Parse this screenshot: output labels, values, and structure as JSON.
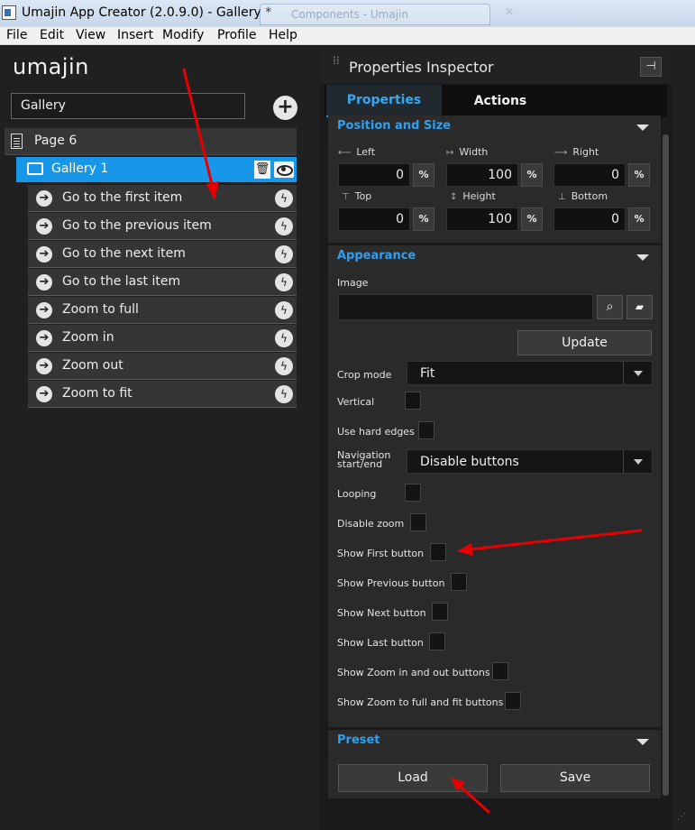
{
  "window": {
    "title": "Umajin App Creator (2.0.9.0) - Gallery *",
    "background_tab": "Components - Umajin"
  },
  "menu": [
    "File",
    "Edit",
    "View",
    "Insert",
    "Modify",
    "Profile",
    "Help"
  ],
  "left_panel": {
    "logo": "umajin",
    "page_field_value": "Gallery",
    "tree": {
      "page_label": "Page 6",
      "gallery_label": "Gallery 1",
      "actions": [
        "Go to the first item",
        "Go to the previous item",
        "Go to the next item",
        "Go to the last item",
        "Zoom to full",
        "Zoom in",
        "Zoom out",
        "Zoom to fit"
      ]
    }
  },
  "inspector": {
    "title": "Properties Inspector",
    "tabs": {
      "properties": "Properties",
      "actions": "Actions"
    },
    "position_size": {
      "header": "Position and Size",
      "fields": {
        "left": {
          "label": "Left",
          "value": "0",
          "unit": "%"
        },
        "width": {
          "label": "Width",
          "value": "100",
          "unit": "%"
        },
        "right": {
          "label": "Right",
          "value": "0",
          "unit": "%"
        },
        "top": {
          "label": "Top",
          "value": "0",
          "unit": "%"
        },
        "height": {
          "label": "Height",
          "value": "100",
          "unit": "%"
        },
        "bottom": {
          "label": "Bottom",
          "value": "0",
          "unit": "%"
        }
      }
    },
    "appearance": {
      "header": "Appearance",
      "image_label": "Image",
      "image_value": "",
      "update_button": "Update",
      "crop_mode_label": "Crop mode",
      "crop_mode_value": "Fit",
      "vertical_label": "Vertical",
      "hard_edges_label": "Use hard edges",
      "navigation_label_line1": "Navigation",
      "navigation_label_line2": "start/end",
      "navigation_value": "Disable buttons",
      "looping_label": "Looping",
      "disable_zoom_label": "Disable zoom",
      "show_first_label": "Show First button",
      "show_previous_label": "Show Previous button",
      "show_next_label": "Show Next button",
      "show_last_label": "Show Last button",
      "show_zoom_inout_label": "Show Zoom in and out buttons",
      "show_zoom_fullfit_label": "Show Zoom to full and fit buttons"
    },
    "preset": {
      "header": "Preset",
      "load_button": "Load",
      "save_button": "Save"
    }
  },
  "colors": {
    "accent_blue": "#1896e8",
    "section_header_text": "#2ea0f2",
    "annotation_red": "#e80000"
  },
  "icons": {
    "add": "plus-icon",
    "page": "document-icon",
    "gallery": "gallery-icon",
    "trash": "trash-icon",
    "visibility": "eye-icon",
    "action_arrow": "arrow-right-icon",
    "action_trigger": "lightning-icon",
    "search": "search-icon",
    "folder": "folder-open-icon",
    "pin": "pin-icon"
  }
}
